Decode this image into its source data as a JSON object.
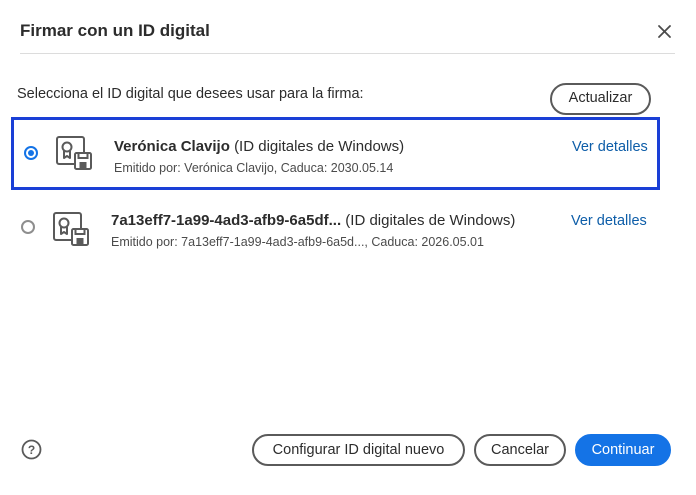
{
  "dialog": {
    "title": "Firmar con un ID digital",
    "close_icon": "close-icon"
  },
  "instruction": "Selecciona el ID digital que desees usar para la firma:",
  "refresh_button": "Actualizar",
  "digital_ids": [
    {
      "name": "Verónica Clavijo",
      "type": "(ID digitales de Windows)",
      "meta": "Emitido por: Verónica Clavijo, Caduca: 2030.05.14",
      "details_link": "Ver detalles",
      "selected": true,
      "icon": "certificate-icon"
    },
    {
      "name": "7a13eff7-1a99-4ad3-afb9-6a5df...",
      "type": "(ID digitales de Windows)",
      "meta": "Emitido por: 7a13eff7-1a99-4ad3-afb9-6a5d..., Caduca: 2026.05.01",
      "details_link": "Ver detalles",
      "selected": false,
      "icon": "certificate-icon"
    }
  ],
  "footer": {
    "help_icon": "help-icon",
    "configure_button": "Configurar ID digital nuevo",
    "cancel_button": "Cancelar",
    "continue_button": "Continuar"
  },
  "colors": {
    "accent": "#1473e6",
    "selection_border": "#1a3fd6",
    "link": "#0d5da8"
  }
}
